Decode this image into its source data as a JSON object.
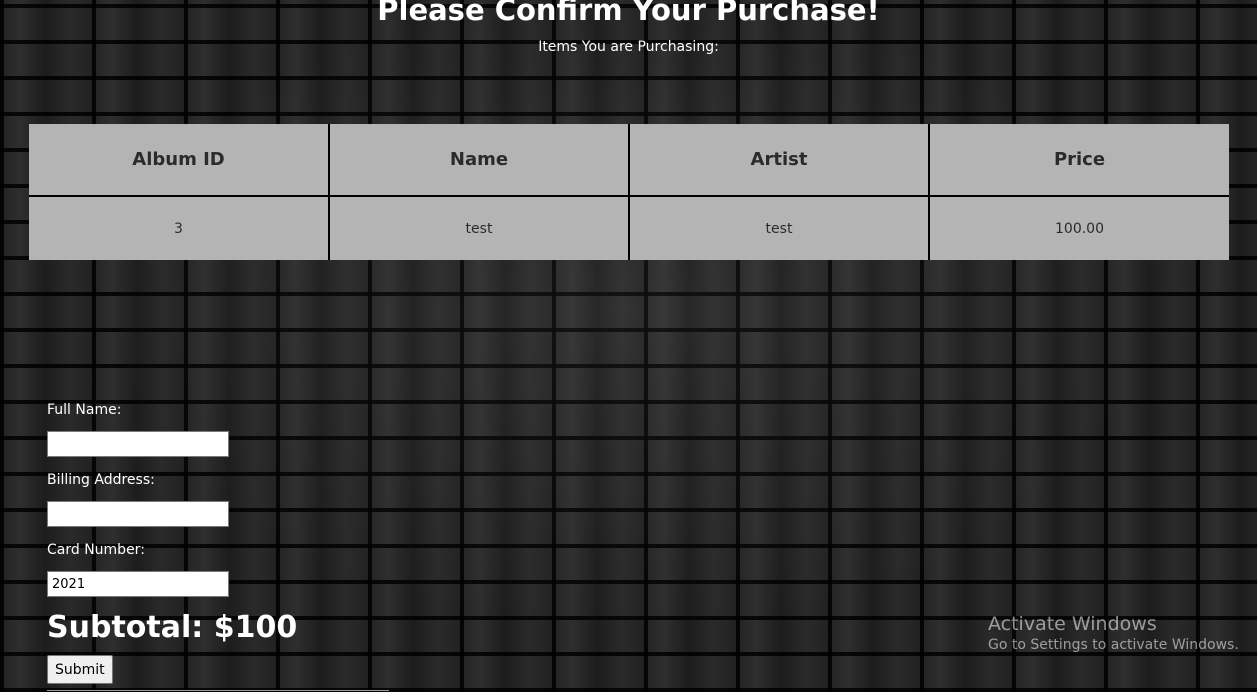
{
  "page": {
    "title": "Please Confirm Your Purchase!",
    "subtitle": "Items You are Purchasing:"
  },
  "table": {
    "headers": [
      "Album ID",
      "Name",
      "Artist",
      "Price"
    ],
    "rows": [
      [
        "3",
        "test",
        "test",
        "100.00"
      ]
    ]
  },
  "form": {
    "full_name_label": "Full Name:",
    "full_name_value": "",
    "billing_address_label": "Billing Address:",
    "billing_address_value": "",
    "card_number_label": "Card Number:",
    "card_number_value": "2021",
    "subtotal_label": "Subtotal: $100",
    "submit_label": "Submit"
  },
  "watermark": {
    "title": "Activate Windows",
    "subtitle": "Go to Settings to activate Windows."
  },
  "colors": {
    "background": "#0b0b0b",
    "table_bg": "#b4b4b4",
    "text": "#ffffff"
  }
}
